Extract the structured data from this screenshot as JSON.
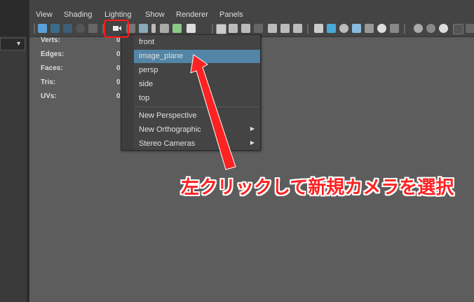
{
  "menubar": {
    "items": [
      "View",
      "Shading",
      "Lighting",
      "Show",
      "Renderer",
      "Panels"
    ]
  },
  "hud": {
    "rows": [
      {
        "label": "Verts:",
        "value": "0"
      },
      {
        "label": "Edges:",
        "value": "0"
      },
      {
        "label": "Faces:",
        "value": "0"
      },
      {
        "label": "Tris:",
        "value": "0"
      },
      {
        "label": "UVs:",
        "value": "0"
      }
    ]
  },
  "camera_menu": {
    "items": [
      {
        "label": "front"
      },
      {
        "label": "image_plane",
        "highlighted": true
      },
      {
        "label": "persp"
      },
      {
        "label": "side"
      },
      {
        "label": "top"
      }
    ],
    "create_items": [
      {
        "label": "New Perspective",
        "submenu": false
      },
      {
        "label": "New Orthographic",
        "submenu": true
      },
      {
        "label": "Stereo Cameras",
        "submenu": true
      }
    ]
  },
  "annotation": {
    "text": "左クリックして新規カメラを選択",
    "color": "#ff2222"
  },
  "colors": {
    "highlight": "#5285a6",
    "viewport": "#5d5d5d",
    "panel": "#444444"
  }
}
